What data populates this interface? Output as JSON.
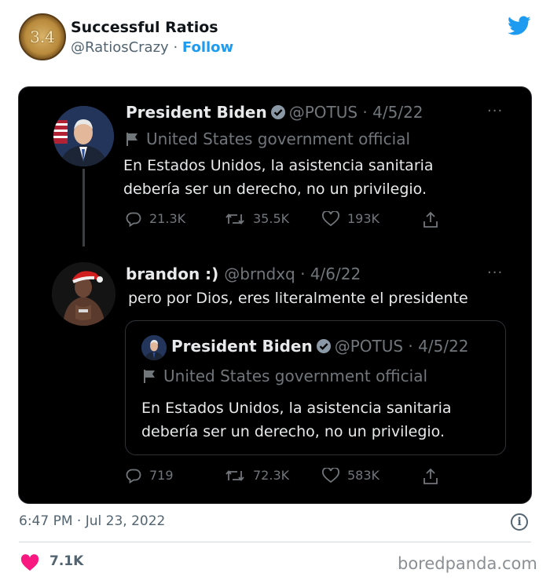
{
  "header": {
    "avatar_text": "3.4",
    "display_name": "Successful Ratios",
    "handle": "@RatiosCrazy",
    "separator": "·",
    "follow_label": "Follow",
    "brand_icon": "twitter-bird-icon",
    "brand_color": "#1d9bf0"
  },
  "screenshot": {
    "background": "#000000",
    "tweet1": {
      "name": "President Biden",
      "handle_date": "@POTUS · 4/5/22",
      "label": "United States government official",
      "text_line1": "En Estados Unidos, la asistencia sanitaria",
      "text_line2": "debería ser un derecho, no un privilegio.",
      "replies": "21.3K",
      "retweets": "35.5K",
      "likes": "193K",
      "more": "···"
    },
    "tweet2": {
      "name": "brandon :)",
      "handle_date": "@brndxq · 4/6/22",
      "text": "pero por  Dios, eres literalmente el presidente",
      "more": "···",
      "replies": "719",
      "retweets": "72.3K",
      "likes": "583K"
    },
    "quoted": {
      "name": "President Biden",
      "handle_date": "@POTUS · 4/5/22",
      "label": "United States government official",
      "text_line1": "En Estados Unidos, la asistencia sanitaria",
      "text_line2": "debería ser un derecho, no un privilegio."
    }
  },
  "footer": {
    "timestamp": "6:47 PM · Jul 23, 2022",
    "info_symbol": "i",
    "like_count": "7.1K",
    "like_color": "#f91880",
    "watermark": "boredpanda.com"
  }
}
